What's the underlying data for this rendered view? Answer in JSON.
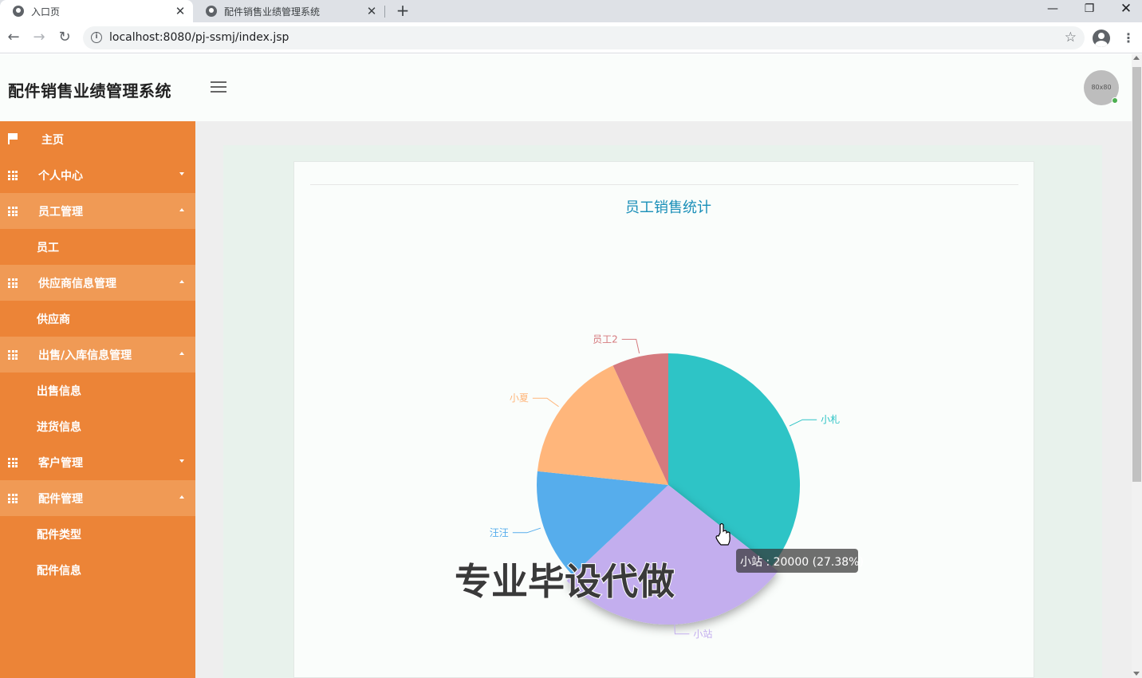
{
  "browser": {
    "tabs": [
      {
        "label": "入口页",
        "active": true
      },
      {
        "label": "配件销售业绩管理系统",
        "active": false
      }
    ],
    "url": "localhost:8080/pj-ssmj/index.jsp"
  },
  "header": {
    "title": "配件销售业绩管理系统",
    "avatar_text": "80x80"
  },
  "sidebar": {
    "items": [
      {
        "label": "主页",
        "icon": "flag-icon",
        "type": "item"
      },
      {
        "label": "个人中心",
        "icon": "grid-icon",
        "type": "group",
        "state": "collapsed"
      },
      {
        "label": "员工管理",
        "icon": "grid-icon",
        "type": "group",
        "state": "expanded"
      },
      {
        "label": "员工",
        "type": "sub"
      },
      {
        "label": "供应商信息管理",
        "icon": "grid-icon",
        "type": "group",
        "state": "expanded"
      },
      {
        "label": "供应商",
        "type": "sub"
      },
      {
        "label": "出售/入库信息管理",
        "icon": "grid-icon",
        "type": "group",
        "state": "expanded"
      },
      {
        "label": "出售信息",
        "type": "sub"
      },
      {
        "label": "进货信息",
        "type": "sub"
      },
      {
        "label": "客户管理",
        "icon": "grid-icon",
        "type": "group",
        "state": "collapsed"
      },
      {
        "label": "配件管理",
        "icon": "grid-icon",
        "type": "group",
        "state": "expanded"
      },
      {
        "label": "配件类型",
        "type": "sub"
      },
      {
        "label": "配件信息",
        "type": "sub"
      }
    ]
  },
  "chart_data": {
    "type": "pie",
    "title": "员工销售统计",
    "slices": [
      {
        "name": "小札",
        "value": 26000,
        "color": "#2ec4c6"
      },
      {
        "name": "小站",
        "value": 20000,
        "color": "#c3aeee"
      },
      {
        "name": "汪汪",
        "value": 10000,
        "color": "#56adec"
      },
      {
        "name": "小夏",
        "value": 12000,
        "color": "#ffb67b"
      },
      {
        "name": "员工2",
        "value": 5046,
        "color": "#d57a7e"
      }
    ],
    "tooltip": "小站 : 20000 (27.38%)"
  },
  "watermark": "专业毕设代做",
  "colors": {
    "sidebar_bg": "#ec8437",
    "sidebar_expanded_bg": "#f09a55",
    "title_color": "#1a8fb8"
  }
}
